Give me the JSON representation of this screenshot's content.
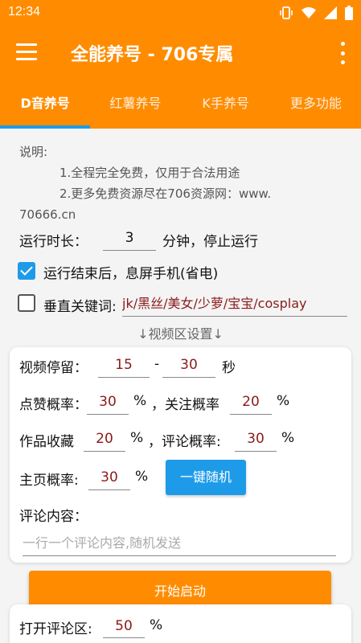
{
  "status_bar": {
    "time": "12:34"
  },
  "app_bar": {
    "title": "全能养号 - 706专属"
  },
  "tabs": [
    {
      "label": "D音养号",
      "active": true
    },
    {
      "label": "红薯养号",
      "active": false
    },
    {
      "label": "K手养号",
      "active": false
    },
    {
      "label": "更多功能",
      "active": false
    }
  ],
  "note": {
    "heading": "说明:",
    "line1": "1.全程完全免费，仅用于合法用途",
    "line2": "2.更多免费资源尽在706资源网：www.",
    "line3": "70666.cn"
  },
  "run_duration": {
    "label": "运行时长：",
    "value": "3",
    "suffix": "分钟，停止运行"
  },
  "screen_off": {
    "label": "运行结束后，息屏手机(省电)",
    "checked": true
  },
  "keyword": {
    "label": "垂直关键词:",
    "value": "jk/黑丝/美女/少萝/宝宝/cosplay",
    "checked": false
  },
  "section_title": "↓视频区设置↓",
  "video_settings": {
    "stay_label": "视频停留：",
    "stay_min": "15",
    "dash": "-",
    "stay_max": "30",
    "stay_unit": "秒",
    "like_label": "点赞概率：",
    "like_value": "30",
    "follow_label": "，关注概率",
    "follow_value": "20",
    "collect_label": "作品收藏",
    "collect_value": "20",
    "comment_rate_label": "，评论概率:",
    "comment_rate_value": "30",
    "homepage_label": "主页概率:",
    "homepage_value": "30",
    "percent": "%",
    "random_button": "一键随机",
    "comment_content_label": "评论内容：",
    "comment_placeholder": "一行一个评论内容,随机发送"
  },
  "start_button": "开始启动",
  "open_comment": {
    "label": "打开评论区:",
    "value": "50",
    "unit": "%"
  },
  "colors": {
    "primary": "#ff8c00",
    "accent": "#1e9be8",
    "value_text": "#8b1a1a"
  }
}
